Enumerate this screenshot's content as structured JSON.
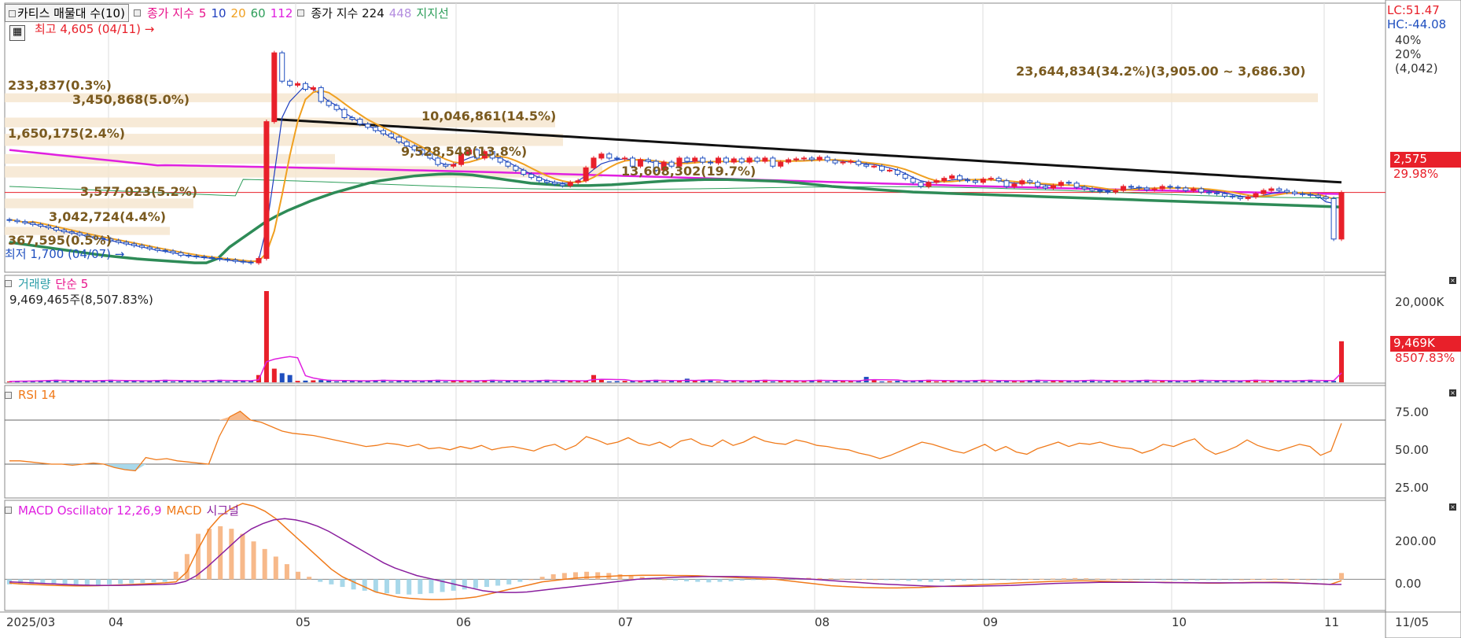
{
  "legends": {
    "price": {
      "title": "카티스 매물대 수(10)",
      "series_label": "종가 지수",
      "periods": [
        "5",
        "10",
        "20",
        "60",
        "112"
      ],
      "period_colors": [
        "#e8148c",
        "#1f3fbf",
        "#f0a020",
        "#2e9e5a",
        "#e020e0"
      ],
      "extra_label": "종가 지수 224",
      "extra_period": "448",
      "support_label": "지지선"
    },
    "volume": {
      "title": "거래량",
      "ma": "단순 5",
      "readout": "9,469,465주(8,507.83%)"
    },
    "rsi": {
      "title": "RSI 14"
    },
    "macd": {
      "title": "MACD Oscillator 12,26,9",
      "macd": "MACD",
      "signal": "시그널"
    }
  },
  "price_panel": {
    "lc": "LC:51.47",
    "hc": "HC:-44.08",
    "pct_40": "40%",
    "pct_20": "20%",
    "ref": "(4,042)",
    "current_price": "2,575",
    "current_change": "29.98%",
    "high_label": "최고 4,605 (04/11)",
    "low_label": "최저 1,700 (04/07)",
    "volume_profile": [
      {
        "label": "23,644,834(34.2%)(3,905.00 ~ 3,686.30)"
      },
      {
        "label": "233,837(0.3%)"
      },
      {
        "label": "3,450,868(5.0%)"
      },
      {
        "label": "10,046,861(14.5%)"
      },
      {
        "label": "1,650,175(2.4%)"
      },
      {
        "label": "9,528,548(13.8%)"
      },
      {
        "label": "13,608,302(19.7%)"
      },
      {
        "label": "3,577,023(5.2%)"
      },
      {
        "label": "3,042,724(4.4%)"
      },
      {
        "label": "367,595(0.5%)"
      }
    ]
  },
  "volume_panel": {
    "axis_top": "20,000K",
    "current": "9,469K",
    "current_pct": "8507.83%"
  },
  "rsi_panel": {
    "ticks": [
      "75.00",
      "50.00",
      "25.00"
    ]
  },
  "macd_panel": {
    "ticks": [
      "200.00",
      "0.00"
    ]
  },
  "x_axis": {
    "labels": [
      "2025/03",
      "04",
      "05",
      "06",
      "07",
      "08",
      "09",
      "10",
      "11",
      "11/05"
    ]
  },
  "colors": {
    "up": "#e8202a",
    "down": "#1f4fbf",
    "ma5": "#e8148c",
    "ma10": "#1f3fbf",
    "ma20": "#f0a020",
    "ma60": "#2e9e5a",
    "ma112": "#e020e0",
    "ma224": "#111111",
    "support": "#2e8b57",
    "rsi": "#f07a1a",
    "macd": "#f07a1a",
    "signal": "#8a1f9e",
    "profile": "#f6e6d0"
  },
  "chart_data": [
    {
      "type": "candlestick",
      "title": "카티스 매물대 수(10)",
      "x": [
        "2025/03",
        "04",
        "05",
        "06",
        "07",
        "08",
        "09",
        "10",
        "11"
      ],
      "high": {
        "value": 4605,
        "date": "04/11"
      },
      "low": {
        "value": 1700,
        "date": "04/07"
      },
      "close_last": 2575,
      "change_last_pct": 29.98,
      "close": [
        2230,
        2215,
        2200,
        2180,
        2160,
        2140,
        2110,
        2090,
        2075,
        2050,
        2030,
        2010,
        2000,
        1980,
        1960,
        1940,
        1920,
        1900,
        1880,
        1860,
        1850,
        1830,
        1800,
        1790,
        1780,
        1770,
        1760,
        1750,
        1740,
        1725,
        1715,
        1706,
        1760,
        3450,
        4300,
        3950,
        3900,
        3920,
        3850,
        3870,
        3700,
        3650,
        3600,
        3500,
        3480,
        3420,
        3380,
        3340,
        3300,
        3260,
        3200,
        3150,
        3100,
        3050,
        3000,
        2920,
        2900,
        2920,
        3050,
        3100,
        3000,
        3080,
        3000,
        2950,
        2900,
        2850,
        2800,
        2760,
        2720,
        2700,
        2680,
        2660,
        2700,
        2720,
        2880,
        3000,
        3050,
        3000,
        2990,
        3000,
        2900,
        2980,
        2960,
        2850,
        2950,
        2900,
        3000,
        2960,
        3000,
        2950,
        2940,
        3000,
        2950,
        2990,
        2950,
        3000,
        2960,
        3000,
        2900,
        2950,
        2980,
        2990,
        3000,
        2980,
        3010,
        2970,
        2940,
        2950,
        2960,
        2920,
        2900,
        2900,
        2850,
        2850,
        2800,
        2750,
        2700,
        2650,
        2700,
        2720,
        2750,
        2780,
        2730,
        2720,
        2700,
        2740,
        2750,
        2720,
        2650,
        2680,
        2720,
        2700,
        2650,
        2630,
        2660,
        2700,
        2690,
        2640,
        2620,
        2600,
        2590,
        2580,
        2600,
        2650,
        2640,
        2630,
        2610,
        2620,
        2650,
        2640,
        2630,
        2600,
        2620,
        2580,
        2570,
        2560,
        2530,
        2520,
        2500,
        2520,
        2560,
        2600,
        2620,
        2600,
        2580,
        2560,
        2550,
        2540,
        2520,
        2500,
        2000,
        2575
      ],
      "ma5": [
        2240,
        2225,
        2205,
        2185,
        2165,
        2145,
        2118,
        2095,
        2078,
        2058,
        2035,
        2015,
        1998,
        1980,
        1962,
        1942,
        1922,
        1902,
        1882,
        1862,
        1848,
        1830,
        1810,
        1794,
        1782,
        1770,
        1762,
        1752,
        1740,
        1730,
        1720,
        1710,
        1742,
        2140,
        2800,
        3500,
        3700,
        3800,
        3900,
        3850,
        3780,
        3700,
        3650,
        3560,
        3500,
        3440,
        3400,
        3360,
        3310,
        3260,
        3210,
        3160,
        3110,
        3060,
        3010,
        2950,
        2920,
        2920,
        2960,
        3000,
        3030,
        3040,
        3020,
        3000,
        2950,
        2900,
        2850,
        2800,
        2760,
        2720,
        2700,
        2690,
        2690,
        2720,
        2780,
        2860,
        2930,
        2960,
        2980,
        2990,
        2980,
        2970,
        2960,
        2940,
        2930,
        2920,
        2940,
        2950,
        2960,
        2960,
        2950,
        2960,
        2960,
        2960,
        2960,
        2970,
        2970,
        2970,
        2960,
        2960,
        2960,
        2970,
        2970,
        2980,
        2980,
        2980,
        2970,
        2960,
        2950,
        2940,
        2930,
        2920,
        2900,
        2880,
        2850,
        2810,
        2760,
        2720,
        2700,
        2700,
        2710,
        2730,
        2740,
        2740,
        2730,
        2730,
        2730,
        2720,
        2700,
        2690,
        2690,
        2690,
        2680,
        2670,
        2660,
        2660,
        2670,
        2660,
        2640,
        2620,
        2610,
        2600,
        2600,
        2610,
        2620,
        2630,
        2630,
        2630,
        2630,
        2630,
        2630,
        2630,
        2620,
        2610,
        2600,
        2590,
        2570,
        2550,
        2530,
        2520,
        2520,
        2540,
        2560,
        2580,
        2580,
        2570,
        2560,
        2550,
        2530,
        2460,
        2440
      ],
      "support": [
        1960,
        1940,
        1920,
        1900,
        1880,
        1860,
        1840,
        1820,
        1800,
        1785,
        1770,
        1755,
        1745,
        1735,
        1725,
        1715,
        1706,
        1706,
        1760,
        1900,
        2000,
        2100,
        2200,
        2280,
        2350,
        2410,
        2470,
        2520,
        2570,
        2610,
        2650,
        2690,
        2720,
        2740,
        2760,
        2780,
        2790,
        2800,
        2805,
        2800,
        2790,
        2770,
        2750,
        2730,
        2710,
        2690,
        2680,
        2670,
        2660,
        2660,
        2660,
        2665,
        2670,
        2680,
        2690,
        2700,
        2710,
        2720,
        2725,
        2730,
        2735,
        2735,
        2735,
        2730,
        2725,
        2720,
        2715,
        2705,
        2695,
        2680,
        2665,
        2650,
        2640,
        2630,
        2620,
        2610,
        2600,
        2590,
        2580,
        2575,
        2570,
        2565,
        2560,
        2555,
        2550,
        2545,
        2540,
        2535,
        2530,
        2525,
        2520,
        2515,
        2510,
        2505,
        2500,
        2495,
        2490,
        2485,
        2480,
        2475,
        2470,
        2465,
        2460,
        2455,
        2450,
        2445,
        2440,
        2435,
        2430,
        2425,
        2420,
        2415,
        2410,
        2405,
        2400,
        2395
      ]
    },
    {
      "type": "bar",
      "title": "거래량",
      "readout_volume": 9469465,
      "readout_pct": 8507.83,
      "last_volume_k": 9469
    },
    {
      "type": "line",
      "title": "RSI 14",
      "ylim": [
        0,
        100
      ],
      "guides": [
        70,
        30
      ],
      "values": [
        33,
        33,
        32,
        31,
        30,
        30,
        29,
        30,
        31,
        30,
        27,
        25,
        24,
        36,
        34,
        35,
        33,
        32,
        31,
        30,
        55,
        73,
        78,
        70,
        68,
        64,
        60,
        58,
        57,
        56,
        54,
        52,
        50,
        48,
        46,
        47,
        49,
        48,
        46,
        48,
        44,
        45,
        43,
        46,
        44,
        47,
        43,
        45,
        46,
        44,
        42,
        46,
        48,
        43,
        47,
        55,
        52,
        48,
        50,
        54,
        49,
        47,
        50,
        45,
        51,
        53,
        48,
        46,
        52,
        47,
        50,
        55,
        51,
        49,
        48,
        52,
        50,
        47,
        46,
        44,
        43,
        40,
        38,
        35,
        38,
        42,
        46,
        50,
        48,
        45,
        42,
        40,
        44,
        48,
        42,
        46,
        41,
        39,
        44,
        47,
        50,
        46,
        49,
        48,
        50,
        47,
        45,
        44,
        40,
        43,
        48,
        46,
        50,
        53,
        44,
        39,
        42,
        46,
        52,
        47,
        44,
        42,
        45,
        48,
        46,
        38,
        42,
        67
      ]
    },
    {
      "type": "bar",
      "title": "MACD Oscillator 12,26,9",
      "ylim": [
        -120,
        300
      ],
      "oscillator": [
        -20,
        -20,
        -18,
        -16,
        -18,
        -20,
        -22,
        -24,
        -22,
        -20,
        -18,
        -16,
        -14,
        -12,
        -10,
        30,
        100,
        180,
        200,
        210,
        200,
        180,
        150,
        120,
        90,
        60,
        30,
        10,
        -10,
        -20,
        -30,
        -40,
        -45,
        -50,
        -55,
        -58,
        -60,
        -58,
        -55,
        -50,
        -45,
        -40,
        -35,
        -30,
        -25,
        -20,
        -10,
        0,
        10,
        20,
        25,
        28,
        30,
        28,
        25,
        20,
        15,
        10,
        5,
        0,
        -5,
        -8,
        -10,
        -12,
        -10,
        -8,
        -5,
        -3,
        0,
        2,
        4,
        5,
        6,
        5,
        4,
        3,
        2,
        1,
        0,
        -2,
        -4,
        -6,
        -8,
        -10,
        -9,
        -8,
        -6,
        -4,
        -3,
        -2,
        -1,
        0,
        1,
        2,
        3,
        4,
        5,
        4,
        3,
        2,
        1,
        0,
        -1,
        -2,
        -3,
        -4,
        -5,
        -4,
        -3,
        -2,
        -1,
        0,
        1,
        2,
        3,
        2,
        1,
        0,
        -1,
        -2,
        25
      ],
      "macd": [
        -15,
        -18,
        -20,
        -22,
        -24,
        -25,
        -26,
        -26,
        -25,
        -24,
        -22,
        -20,
        -18,
        -16,
        -14,
        -10,
        30,
        120,
        200,
        250,
        280,
        300,
        290,
        270,
        240,
        200,
        160,
        120,
        80,
        40,
        10,
        -10,
        -30,
        -50,
        -60,
        -70,
        -75,
        -78,
        -80,
        -80,
        -78,
        -75,
        -70,
        -60,
        -50,
        -40,
        -30,
        -20,
        -10,
        -5,
        0,
        5,
        8,
        10,
        12,
        14,
        15,
        16,
        16,
        16,
        15,
        15,
        14,
        12,
        10,
        8,
        6,
        4,
        2,
        0,
        -5,
        -10,
        -15,
        -20,
        -25,
        -28,
        -30,
        -32,
        -33,
        -34,
        -34,
        -33,
        -32,
        -30,
        -28,
        -26,
        -24,
        -22,
        -20,
        -18,
        -16,
        -14,
        -12,
        -10,
        -8,
        -7,
        -6,
        -6,
        -7,
        -8,
        -9,
        -10,
        -11,
        -12,
        -12,
        -13,
        -14,
        -14,
        -15,
        -15,
        -14,
        -13,
        -12,
        -12,
        -11,
        -12,
        -14,
        -16,
        -18,
        -20,
        -5
      ],
      "signal": [
        -10,
        -12,
        -14,
        -16,
        -18,
        -20,
        -22,
        -23,
        -24,
        -24,
        -24,
        -23,
        -22,
        -21,
        -20,
        -18,
        -8,
        15,
        50,
        90,
        130,
        170,
        200,
        220,
        235,
        240,
        235,
        225,
        210,
        190,
        165,
        140,
        115,
        90,
        65,
        45,
        30,
        15,
        5,
        -5,
        -15,
        -25,
        -35,
        -45,
        -50,
        -52,
        -52,
        -50,
        -45,
        -40,
        -35,
        -30,
        -25,
        -20,
        -15,
        -10,
        -5,
        0,
        3,
        5,
        7,
        9,
        10,
        11,
        11,
        11,
        11,
        10,
        9,
        8,
        6,
        4,
        2,
        0,
        -3,
        -6,
        -9,
        -12,
        -15,
        -18,
        -20,
        -22,
        -24,
        -26,
        -27,
        -28,
        -28,
        -28,
        -27,
        -26,
        -25,
        -24,
        -22,
        -20,
        -18,
        -16,
        -15,
        -14,
        -13,
        -12,
        -12,
        -12,
        -12,
        -12,
        -12,
        -13,
        -13,
        -13,
        -14,
        -14,
        -14,
        -14,
        -14,
        -13,
        -13,
        -13,
        -14,
        -15,
        -16,
        -18,
        -20,
        -20
      ]
    }
  ]
}
